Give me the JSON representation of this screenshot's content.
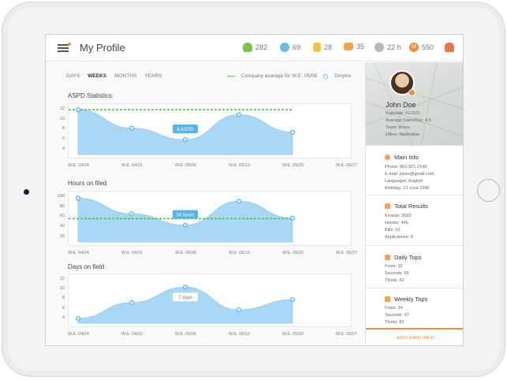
{
  "header": {
    "title": "My Profile",
    "stats": [
      {
        "icon": "hand-icon",
        "value": "282",
        "color": "#7cc34a"
      },
      {
        "icon": "chat-icon",
        "value": "69",
        "color": "#6bbbe9"
      },
      {
        "icon": "notes-icon",
        "value": "28",
        "color": "#f5c342"
      },
      {
        "icon": "wallet-icon",
        "value": "35",
        "color": "#f5a34a"
      },
      {
        "icon": "clock-icon",
        "value": "22 h",
        "color": "#999999"
      },
      {
        "icon": "coin-icon",
        "value": "550",
        "color": "#f58a3a"
      },
      {
        "icon": "users-icon",
        "value": "",
        "color": "#e8764a"
      }
    ]
  },
  "filters": {
    "tabs": [
      "DAYS",
      "WEEKS",
      "MONTHS",
      "YEARS"
    ],
    "active": "WEEKS",
    "legend_company": "Company avarage for W.E. 05/06",
    "legend_user": "Dmytro"
  },
  "charts": {
    "aspd": {
      "title": "ASPD Statistics",
      "tooltip": "6 ASPD"
    },
    "hours": {
      "title": "Hours on filed",
      "tooltip": "24 hours"
    },
    "days": {
      "title": "Days on field",
      "tooltip": "7 days"
    }
  },
  "chart_data": [
    {
      "type": "area",
      "title": "ASPD Statistics",
      "categories": [
        "W.E. 04/24",
        "W.E. 04/31",
        "W.E. 05/06",
        "W.E. 05/13",
        "W.E. 05/20",
        "W.E. 05/27"
      ],
      "yticks": [
        4,
        6,
        8,
        10,
        12
      ],
      "ylim": [
        3,
        12.5
      ],
      "series": [
        {
          "name": "Dmytro",
          "values": [
            12,
            8.3,
            6,
            11,
            7.5
          ]
        }
      ],
      "company_average": 12,
      "grid": false
    },
    {
      "type": "area",
      "title": "Hours on filed",
      "categories": [
        "W.E. 04/24",
        "W.E. 04/31",
        "W.E. 05/06",
        "W.E. 05/13",
        "W.E. 05/20",
        "W.E. 05/27"
      ],
      "yticks": [
        20,
        40,
        60,
        80,
        100
      ],
      "ylim": [
        10,
        105
      ],
      "series": [
        {
          "name": "Dmytro",
          "values": [
            98,
            67,
            44,
            92,
            58
          ]
        }
      ],
      "company_average": 57,
      "grid": false
    },
    {
      "type": "area",
      "title": "Days on field",
      "categories": [
        "W.E. 04/24",
        "W.E. 04/31",
        "W.E. 05/06",
        "W.E. 05/13",
        "W.E. 05/20",
        "W.E. 05/27"
      ],
      "yticks": [
        4,
        6,
        8,
        10,
        12
      ],
      "ylim": [
        3,
        12.5
      ],
      "series": [
        {
          "name": "Dmytro",
          "values": [
            4,
            7.3,
            10.5,
            5.8,
            7.9
          ]
        }
      ],
      "grid": false
    }
  ],
  "profile": {
    "name": "John Doe",
    "rapcode": "Rapcode: #11923",
    "avg_sales": "Avarage Sales/Day: 4.5",
    "team": "Team: Bravo",
    "office": "Office: Manhattan"
  },
  "main_info": {
    "title": "Main Info",
    "lines": [
      "Phone: 862-821-2149",
      "E-mail: jones@gmail.com",
      "Languages: English",
      "Birthday: 13 June 1986"
    ]
  },
  "total_results": {
    "title": "Total Results",
    "lines": [
      "Knocks: 2693",
      "Homes: 445",
      "Bills: 23",
      "Applications: 8"
    ]
  },
  "daily_tops": {
    "title": "Daily Tops",
    "lines": [
      "Firsts: 32",
      "Seconds: 56",
      "Thirds: 83"
    ]
  },
  "weekly_tops": {
    "title": "Weekly Tops",
    "lines": [
      "Firsts: 34",
      "Seconds: 47",
      "Thirds: 83"
    ]
  },
  "edit_button": "EDIT MAIN INFO"
}
